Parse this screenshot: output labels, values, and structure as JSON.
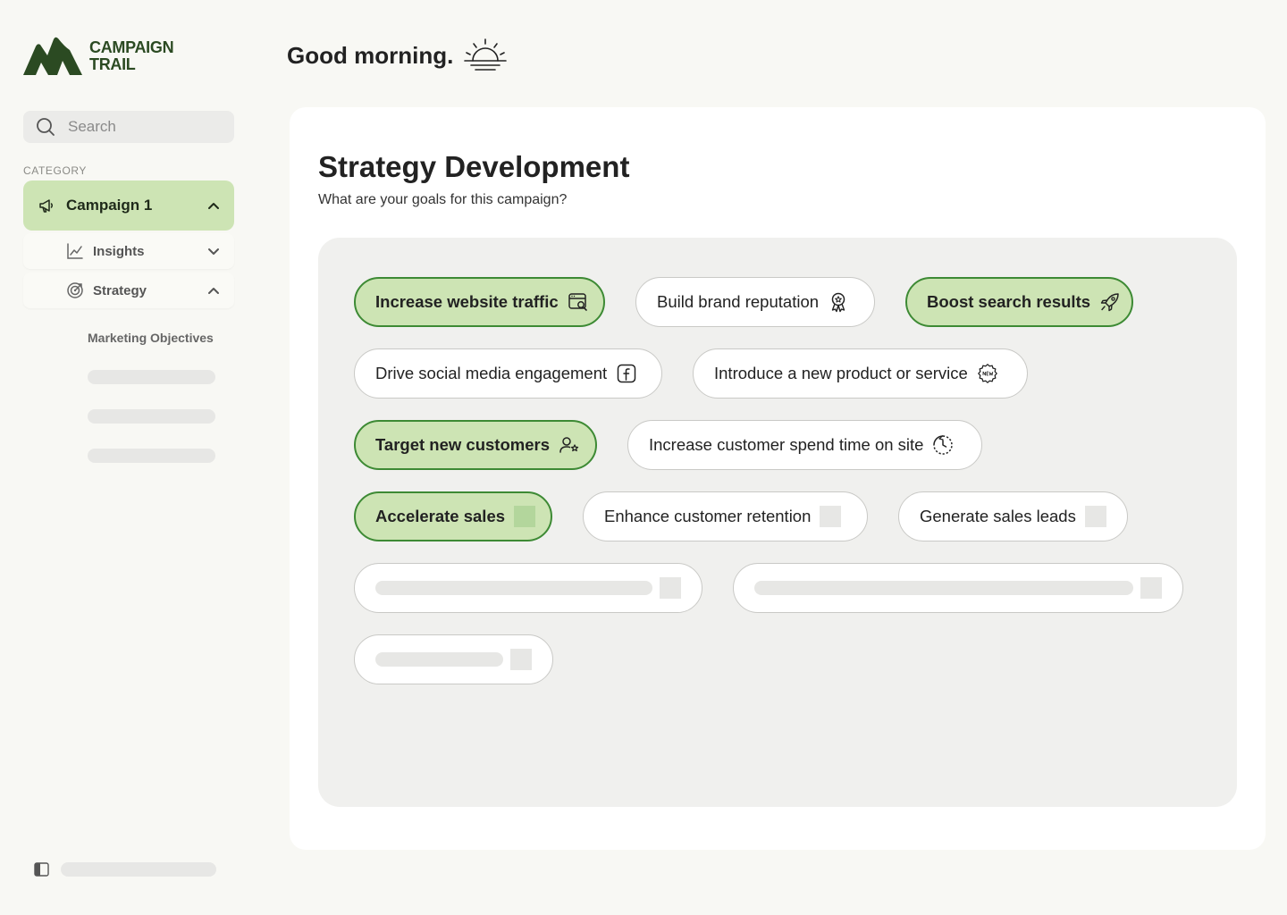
{
  "brand": {
    "line1": "CAMPAIGN",
    "line2": "TRAIL",
    "color": "#2b4a22"
  },
  "search": {
    "placeholder": "Search"
  },
  "sidebar": {
    "category_label": "CATEGORY",
    "campaign": {
      "label": "Campaign 1",
      "icon": "megaphone-icon",
      "expanded": true
    },
    "items": [
      {
        "label": "Insights",
        "icon": "line-chart-icon",
        "expanded": false
      },
      {
        "label": "Strategy",
        "icon": "target-icon",
        "expanded": true
      }
    ],
    "strategy_children": [
      "Marketing Objectives"
    ]
  },
  "header": {
    "greeting": "Good morning.",
    "icon": "sunrise-icon"
  },
  "main": {
    "title": "Strategy Development",
    "subtitle": "What are your goals for this campaign?",
    "goals": [
      {
        "label": "Increase website traffic",
        "selected": true,
        "icon": "browser-search-icon"
      },
      {
        "label": "Build brand reputation",
        "selected": false,
        "icon": "award-ribbon-icon"
      },
      {
        "label": "Boost search results",
        "selected": true,
        "icon": "rocket-icon"
      },
      {
        "label": "Drive social media engagement",
        "selected": false,
        "icon": "facebook-icon"
      },
      {
        "label": "Introduce a new product or service",
        "selected": false,
        "icon": "new-badge-icon"
      },
      {
        "label": "Target new customers",
        "selected": true,
        "icon": "user-star-icon"
      },
      {
        "label": "Increase customer spend time on site",
        "selected": false,
        "icon": "clock-dashed-icon"
      },
      {
        "label": "Accelerate sales",
        "selected": true,
        "icon": "placeholder-icon"
      },
      {
        "label": "Enhance customer retention",
        "selected": false,
        "icon": "placeholder-icon"
      },
      {
        "label": "Generate sales leads",
        "selected": false,
        "icon": "placeholder-icon"
      }
    ]
  },
  "colors": {
    "accent_fill": "#cde4b4",
    "accent_border": "#3d8a34",
    "background": "#f8f8f4",
    "panel": "#f0f0ee"
  }
}
